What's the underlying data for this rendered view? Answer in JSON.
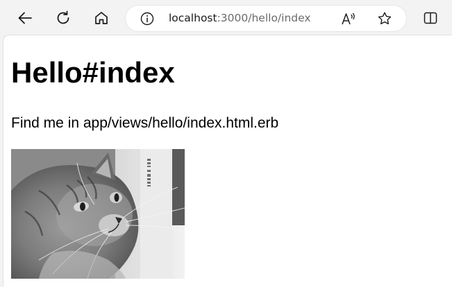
{
  "browser": {
    "address_bar": {
      "host": "localhost",
      "path": ":3000/hello/index"
    },
    "icons": {
      "back": "back-arrow-icon",
      "reload": "reload-icon",
      "home": "home-icon",
      "info": "info-icon",
      "read_aloud": "read-aloud-icon",
      "favorite": "star-icon",
      "split_screen": "split-screen-icon"
    }
  },
  "page": {
    "heading": "Hello#index",
    "body_text": "Find me in app/views/hello/index.html.erb",
    "image": {
      "subject": "grayscale photo of a fluffy cat",
      "watermark_text": "VERTICAL"
    }
  },
  "colors": {
    "toolbar_bg": "#f3f3f3",
    "page_bg": "#ffffff",
    "url_host": "#1a1a1a",
    "url_path": "#6b6b6b"
  }
}
